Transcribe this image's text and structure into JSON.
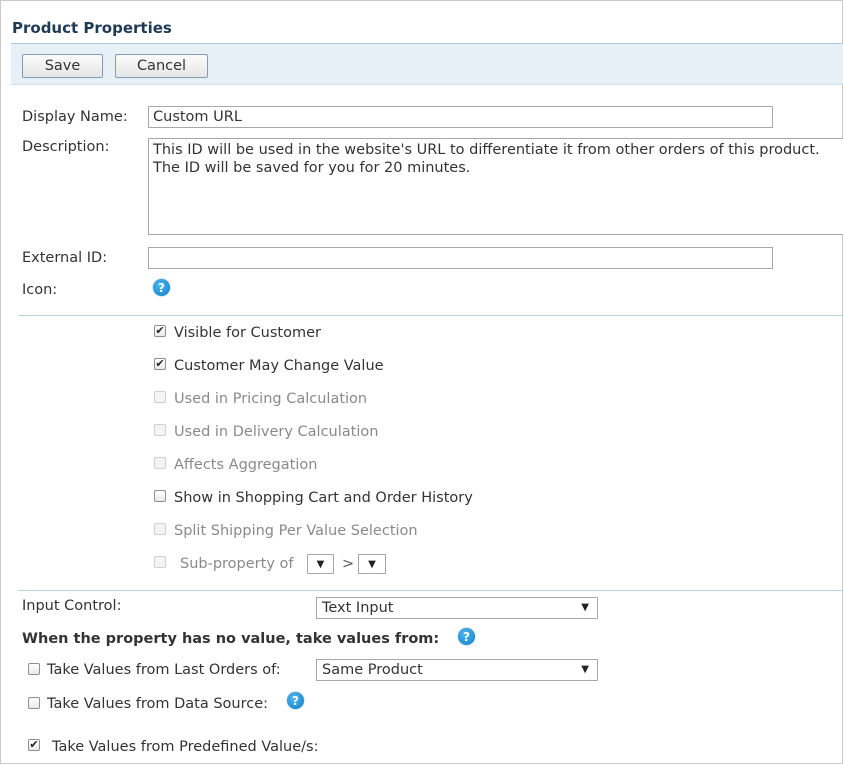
{
  "header": {
    "title": "Product Properties"
  },
  "toolbar": {
    "save_label": "Save",
    "cancel_label": "Cancel"
  },
  "form": {
    "display_name_label": "Display Name:",
    "display_name_value": "Custom URL",
    "description_label": "Description:",
    "description_value": "This ID will be used in the website's URL to differentiate it from other orders of this product. The ID will be saved for you for 20 minutes.",
    "external_id_label": "External ID:",
    "external_id_value": "",
    "icon_label": "Icon:"
  },
  "options": {
    "visible_for_customer": {
      "label": "Visible for Customer",
      "checked": true,
      "enabled": true
    },
    "customer_may_change": {
      "label": "Customer May Change Value",
      "checked": true,
      "enabled": true
    },
    "used_in_pricing": {
      "label": "Used in Pricing Calculation",
      "checked": false,
      "enabled": false
    },
    "used_in_delivery": {
      "label": "Used in Delivery Calculation",
      "checked": false,
      "enabled": false
    },
    "affects_aggregation": {
      "label": "Affects Aggregation",
      "checked": false,
      "enabled": false
    },
    "show_in_cart": {
      "label": "Show in Shopping Cart and Order History",
      "checked": false,
      "enabled": true
    },
    "split_shipping": {
      "label": "Split Shipping Per Value Selection",
      "checked": false,
      "enabled": false
    },
    "sub_property": {
      "label": "Sub-property of",
      "separator": ">",
      "checked": false,
      "enabled": false
    }
  },
  "input_control": {
    "label": "Input Control:",
    "value": "Text Input"
  },
  "no_value_section": {
    "heading": "When the property has no value, take values from:",
    "last_orders": {
      "label": "Take Values from Last Orders of:",
      "checked": false,
      "select_value": "Same Product"
    },
    "data_source": {
      "label": "Take Values from Data Source:",
      "checked": false
    },
    "predefined": {
      "label": "Take Values from Predefined Value/s:",
      "checked": true
    }
  },
  "icons": {
    "help": "question-mark-help-icon",
    "checkmark": "✔",
    "dropdown": "▼"
  }
}
